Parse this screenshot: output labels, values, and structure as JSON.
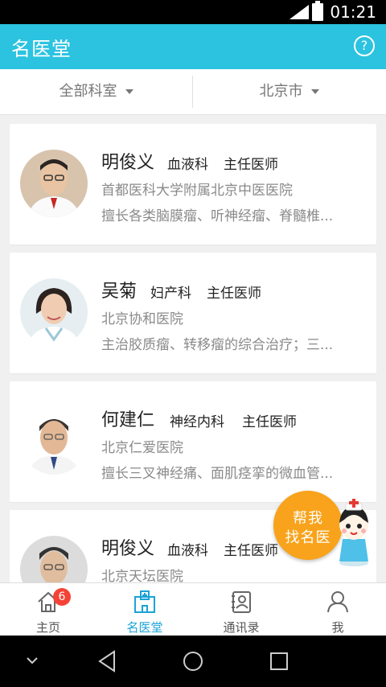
{
  "status_bar": {
    "time": "01:21"
  },
  "app": {
    "title": "名医堂",
    "help_icon": "question-circle-icon"
  },
  "filters": [
    {
      "label": "全部科室"
    },
    {
      "label": "北京市"
    }
  ],
  "doctors": [
    {
      "name": "明俊义",
      "department": "血液科",
      "title": "主任医师",
      "hospital": "首都医科大学附属北京中医医院",
      "description": "擅长各类脑膜瘤、听神经瘤、脊髓椎..."
    },
    {
      "name": "吴菊",
      "department": "妇产科",
      "title": "主任医师",
      "hospital": "北京协和医院",
      "description": "主治胶质瘤、转移瘤的综合治疗；三..."
    },
    {
      "name": "何建仁",
      "department": "神经内科",
      "title": "主任医师",
      "hospital": "北京仁爱医院",
      "description": "擅长三叉神经痛、面肌痉挛的微血管..."
    },
    {
      "name": "明俊义",
      "department": "血液科",
      "title": "主任医师",
      "hospital": "北京天坛医院",
      "description": ""
    }
  ],
  "fab": {
    "line1": "帮我",
    "line2": "找名医",
    "color": "#f8a31b"
  },
  "bottom_nav": [
    {
      "label": "主页",
      "icon": "home-icon",
      "badge": "6"
    },
    {
      "label": "名医堂",
      "icon": "hospital-icon",
      "active": true
    },
    {
      "label": "通讯录",
      "icon": "contacts-icon"
    },
    {
      "label": "我",
      "icon": "person-icon"
    }
  ],
  "colors": {
    "primary": "#2bc3e0",
    "active_nav": "#1aa3d7",
    "badge": "#f44336"
  }
}
